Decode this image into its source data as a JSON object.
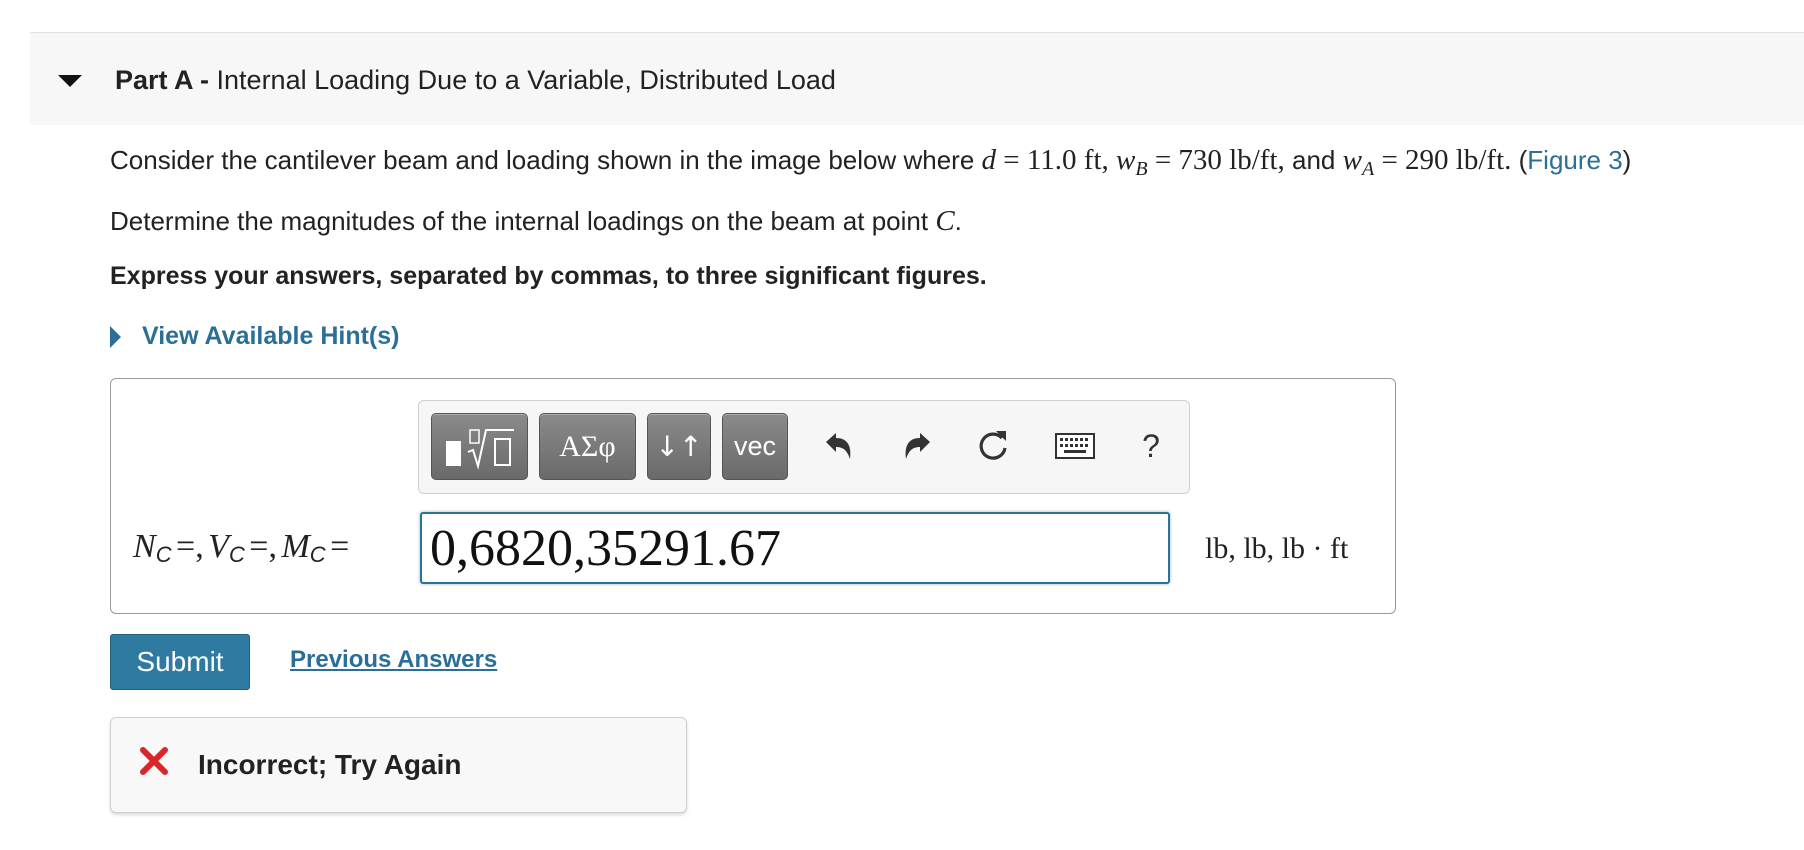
{
  "part": {
    "prefix": "Part A -",
    "title": "Internal Loading Due to a Variable, Distributed Load"
  },
  "problem": {
    "intro": "Consider the cantilever beam and loading shown in the image below where",
    "d_sym": "d",
    "d_val": "= 11.0 ft,",
    "wb_sym": "w",
    "wb_sub": "B",
    "wb_val": "= 730 lb/ft,",
    "and_text": "and",
    "wa_sym": "w",
    "wa_sub": "A",
    "wa_val": "= 290 lb/ft.",
    "fig_open": "(",
    "fig_link": "Figure 3",
    "fig_close": ")",
    "determine": "Determine the magnitudes of the internal loadings on the beam at point",
    "point_sym": "C",
    "point_end": ".",
    "instructions": "Express your answers, separated by commas, to three significant figures."
  },
  "hint": {
    "label": "View Available Hint(s)"
  },
  "toolbar": {
    "greek_label": "ΑΣφ",
    "arrows_label": "↓↑",
    "vec_label": "vec",
    "help_label": "?"
  },
  "equation": {
    "n_sym": "N",
    "n_sub": "C",
    "n_eq": "=,",
    "v_sym": "V",
    "v_sub": "C",
    "v_eq": "=,",
    "m_sym": "M",
    "m_sub": "C",
    "m_eq": "="
  },
  "answer": {
    "value": "0,6820,35291.67"
  },
  "units": "lb, lb, lb · ft",
  "buttons": {
    "submit": "Submit",
    "previous_answers": "Previous Answers"
  },
  "feedback": {
    "message": "Incorrect; Try Again"
  },
  "colors": {
    "accent": "#2e7aa0",
    "link": "#2a6f97",
    "error": "#d9262b"
  }
}
